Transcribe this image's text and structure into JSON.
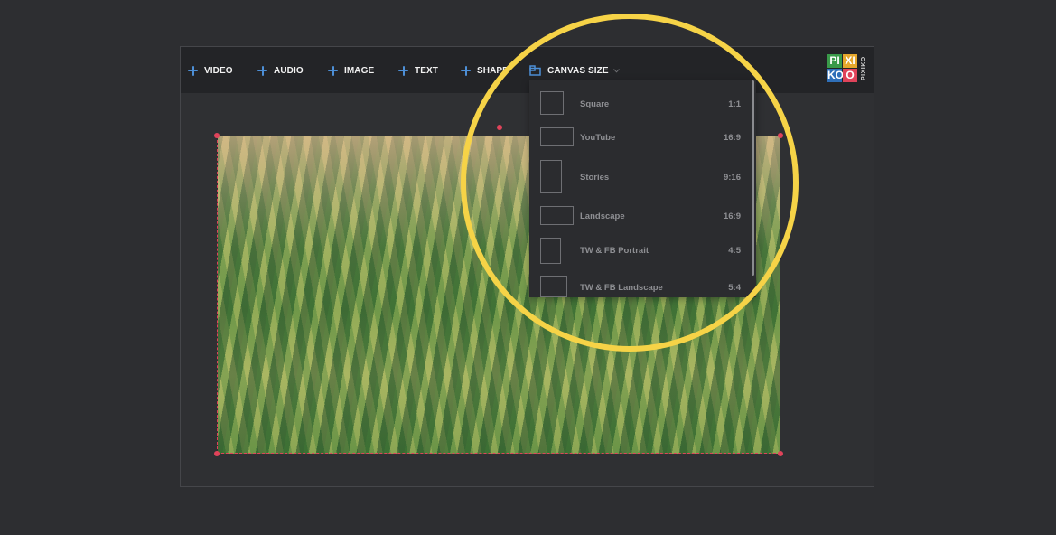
{
  "toolbar": {
    "buttons": [
      {
        "label": "VIDEO"
      },
      {
        "label": "AUDIO"
      },
      {
        "label": "IMAGE"
      },
      {
        "label": "TEXT"
      },
      {
        "label": "SHAPE"
      }
    ],
    "canvas_size_label": "CANVAS SIZE"
  },
  "logo": {
    "cells": [
      "PI",
      "XI",
      "KO",
      "O"
    ],
    "side_text": "PIXIKO",
    "colors": [
      "#3a9a4a",
      "#e6a82c",
      "#2f6fb8",
      "#e0435a"
    ]
  },
  "dropdown": {
    "items": [
      {
        "label": "Square",
        "ratio": "1:1"
      },
      {
        "label": "YouTube",
        "ratio": "16:9"
      },
      {
        "label": "Stories",
        "ratio": "9:16"
      },
      {
        "label": "Landscape",
        "ratio": "16:9"
      },
      {
        "label": "TW & FB Portrait",
        "ratio": "4:5"
      },
      {
        "label": "TW & FB Landscape",
        "ratio": "5:4"
      }
    ]
  },
  "colors": {
    "accent_blue": "#4d8fd6",
    "selection_red": "#e0435a",
    "highlight_yellow": "#f6d347"
  }
}
